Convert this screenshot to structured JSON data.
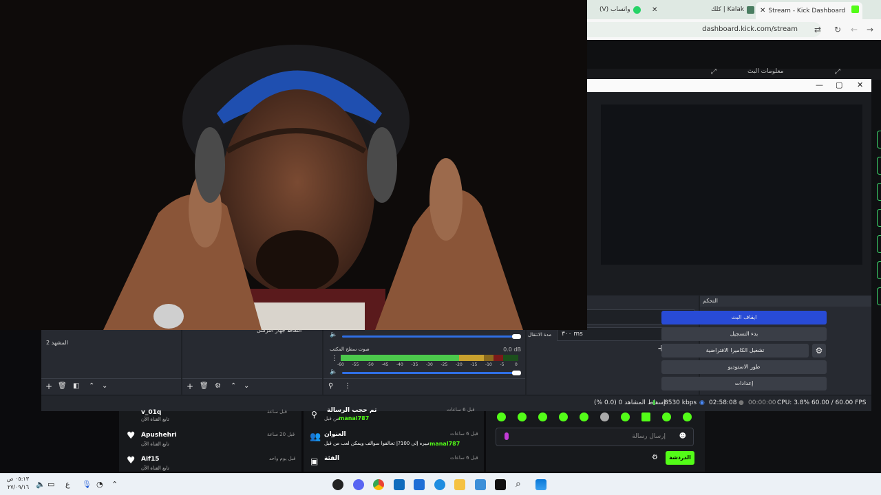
{
  "browser": {
    "tabs": [
      {
        "label": "Stream - Kick Dashboard",
        "active": true
      },
      {
        "label": "كلك | Kalak",
        "active": false
      },
      {
        "label": "(V) واتساب",
        "active": false
      }
    ],
    "url": "dashboard.kick.com/stream",
    "accent": "#53fc18"
  },
  "kick_header": {
    "left_label": "معلومات البث"
  },
  "obs": {
    "controls_title": "التحكم",
    "buttons": {
      "stop_stream": "ايقاف البث",
      "start_recording": "بدء التسجيل",
      "virtual_camera": "تشغيل الكاميرا الافتراضية",
      "studio_mode": "طور الاستوديو",
      "settings": "إعدادات"
    },
    "scenes": [
      "المشهد 2"
    ],
    "sources": [
      "التقاط جهاز الترسل"
    ],
    "audio": {
      "mic_label": "صوت سطح المكتب",
      "mic_db": "0.0 dB",
      "scale": [
        "-60",
        "-55",
        "-50",
        "-45",
        "-40",
        "-35",
        "-30",
        "-25",
        "-20",
        "-15",
        "-10",
        "-5",
        "0"
      ],
      "mic_level": 0.84
    },
    "transition": {
      "duration_label": "مدة الانتقال",
      "duration_value": "٣٠٠ ms"
    },
    "status": {
      "fps": "60.00 / 60.00 FPS",
      "cpu": "CPU: 3.8%",
      "rec_time": "00:00:00",
      "live_time": "02:58:08",
      "bitrate": "8530 kbps",
      "dropped": "إسقاط المشاهد 0 (0.0 %)"
    }
  },
  "activity": {
    "col1": [
      {
        "name": "v_01q",
        "sub": "تابع القناة الآن",
        "time": "قبل ساعة"
      },
      {
        "name": "Apushehri",
        "sub": "تابع القناة الآن",
        "time": "قبل 20 ساعة"
      },
      {
        "name": "Aif15",
        "sub": "تابع القناة الآن",
        "time": "قبل يوم واحد"
      }
    ],
    "col2": [
      {
        "title": "تم حجب الرسالة",
        "sub_prefix": "من قبل",
        "user": "manal787",
        "time": "قبل 6 ساعات"
      },
      {
        "title": "العنوان",
        "text_user": "manal787",
        "text": "تم تغييره إلى 100?| تحالفوا سوالف ويمكن لعب من قبل",
        "time": "قبل 6 ساعات"
      },
      {
        "title": "الفئة",
        "sub": "",
        "time": "قبل 6 ساعات"
      }
    ]
  },
  "chat": {
    "placeholder": "إرسال رسالة",
    "send": "الدردشة"
  },
  "taskbar": {
    "time": "٠٥:١٣ ص",
    "date": "٢٧/٠٩/١٦",
    "lang": "ع"
  }
}
